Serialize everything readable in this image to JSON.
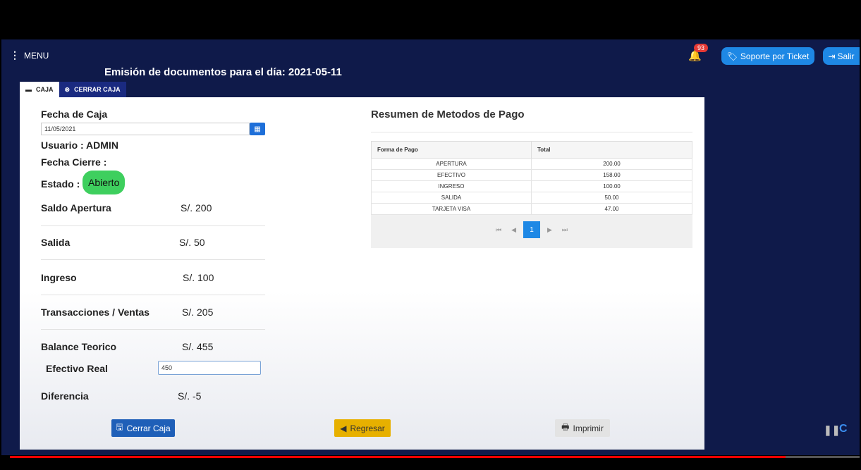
{
  "header": {
    "menu_label": "MENU",
    "title": "Emisión de documentos para el día: 2021-05-11",
    "notification_count": "93",
    "soporte_label": "Soporte por Ticket",
    "salir_label": "Salir"
  },
  "tabs": [
    {
      "label": "CAJA"
    },
    {
      "label": "CERRAR CAJA"
    }
  ],
  "caja": {
    "fecha_label": "Fecha de Caja",
    "fecha_value": "11/05/2021",
    "usuario_label": "Usuario : ADMIN",
    "fecha_cierre_label": "Fecha Cierre :",
    "estado_label": "Estado :",
    "estado_value": "Abierto",
    "rows": [
      {
        "label": "Saldo Apertura",
        "value": "S/. 200"
      },
      {
        "label": "Salida",
        "value": "S/. 50"
      },
      {
        "label": "Ingreso",
        "value": "S/. 100"
      },
      {
        "label": "Transacciones / Ventas",
        "value": "S/. 205"
      },
      {
        "label": "Balance Teorico",
        "value": "S/. 455"
      }
    ],
    "efectivo_label": "Efectivo Real",
    "efectivo_value": "450",
    "diferencia_label": "Diferencia",
    "diferencia_value": "S/. -5"
  },
  "resumen": {
    "title": "Resumen de Metodos de Pago",
    "columns": [
      "Forma de Pago",
      "Total"
    ],
    "rows": [
      [
        "APERTURA",
        "200.00"
      ],
      [
        "EFECTIVO",
        "158.00"
      ],
      [
        "INGRESO",
        "100.00"
      ],
      [
        "SALIDA",
        "50.00"
      ],
      [
        "TARJETA VISA",
        "47.00"
      ]
    ],
    "current_page": "1"
  },
  "buttons": {
    "cerrar_caja": "Cerrar Caja",
    "regresar": "Regresar",
    "imprimir": "Imprimir"
  },
  "colors": {
    "navy": "#0f1a4a",
    "primary": "#1e88e5",
    "success": "#3ecf5e",
    "warning": "#e7b000"
  }
}
